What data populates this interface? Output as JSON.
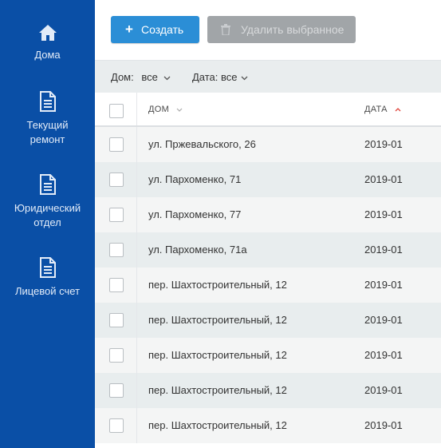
{
  "sidebar": {
    "items": [
      {
        "label": "Дома",
        "icon": "home-icon"
      },
      {
        "label": "Текущий ремонт",
        "icon": "document-icon"
      },
      {
        "label": "Юридический отдел",
        "icon": "document-icon"
      },
      {
        "label": "Лицевой счет",
        "icon": "document-icon"
      }
    ]
  },
  "toolbar": {
    "create_label": "Создать",
    "delete_label": "Удалить выбранное"
  },
  "filters": {
    "house_label": "Дом:",
    "house_value": "все",
    "date_label": "Дата: все"
  },
  "table": {
    "columns": {
      "house": "ДОМ",
      "date": "ДАТА"
    },
    "sort": {
      "column": "date",
      "direction": "ascending"
    },
    "rows": [
      {
        "house": "ул. Пржевальского, 26",
        "date": "2019-01"
      },
      {
        "house": "ул. Пархоменко, 71",
        "date": "2019-01"
      },
      {
        "house": "ул. Пархоменко, 77",
        "date": "2019-01"
      },
      {
        "house": "ул. Пархоменко, 71а",
        "date": "2019-01"
      },
      {
        "house": "пер. Шахтостроительный, 12",
        "date": "2019-01"
      },
      {
        "house": "пер. Шахтостроительный, 12",
        "date": "2019-01"
      },
      {
        "house": "пер. Шахтостроительный, 12",
        "date": "2019-01"
      },
      {
        "house": "пер. Шахтостроительный, 12",
        "date": "2019-01"
      },
      {
        "house": "пер. Шахтостроительный, 12",
        "date": "2019-01"
      }
    ]
  },
  "colors": {
    "sidebar": "#0a4fa6",
    "primary_button": "#2b8ed6",
    "disabled_button": "#a1a5a8",
    "sort_arrow": "#e0443a"
  }
}
